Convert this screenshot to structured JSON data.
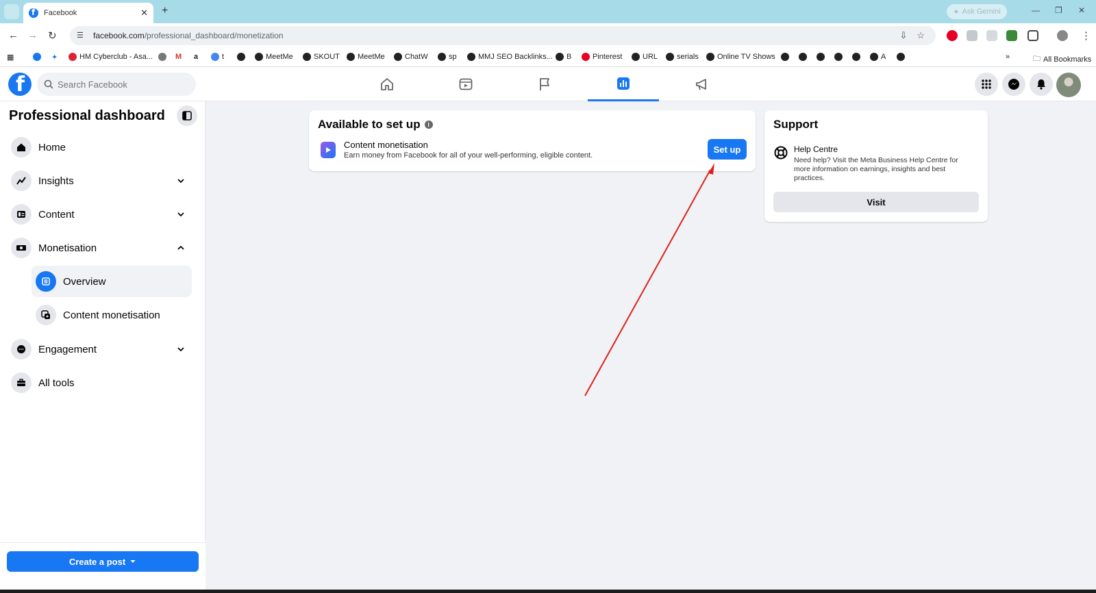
{
  "browser": {
    "tab_title": "Facebook",
    "gemini_label": "Ask Gemini",
    "url_domain": "facebook.com",
    "url_path": "/professional_dashboard/monetization",
    "bookmarks": [
      "HM Cyberclub - Asa...",
      "t",
      "MeetMe",
      "SKOUT",
      "MeetMe",
      "ChatW",
      "sp",
      "MMJ SEO Backlinks...",
      "B",
      "Pinterest",
      "URL",
      "serials",
      "Online TV Shows",
      "A"
    ],
    "all_bookmarks_label": "All Bookmarks"
  },
  "fbnav": {
    "search_placeholder": "Search Facebook"
  },
  "sidebar": {
    "title": "Professional dashboard",
    "items": {
      "home": "Home",
      "insights": "Insights",
      "content": "Content",
      "monetisation": "Monetisation",
      "overview": "Overview",
      "content_monetisation": "Content monetisation",
      "engagement": "Engagement",
      "all_tools": "All tools"
    },
    "create_post": "Create a post"
  },
  "main": {
    "setup_card": {
      "title": "Available to set up",
      "item_title": "Content monetisation",
      "item_desc": "Earn money from Facebook for all of your well-performing, eligible content.",
      "button": "Set up"
    },
    "support_card": {
      "title": "Support",
      "help_title": "Help Centre",
      "help_desc": "Need help? Visit the Meta Business Help Centre for more information on earnings, insights and best practices.",
      "button": "Visit"
    }
  },
  "colors": {
    "brand_blue": "#1877f2",
    "annotation_arrow": "#e0201b"
  }
}
